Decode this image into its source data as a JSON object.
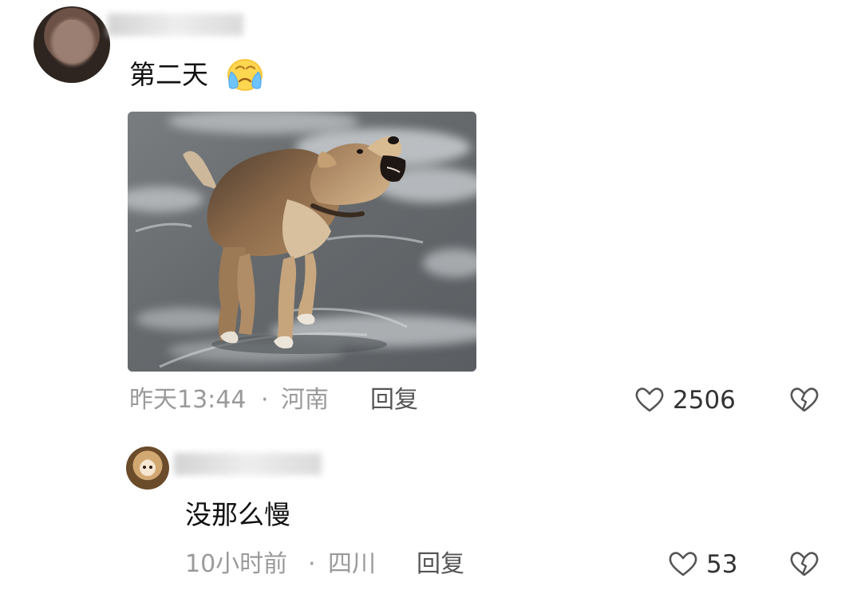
{
  "comments": [
    {
      "text": "第二天",
      "emoji": "crying-face-icon",
      "image": "barking-dog-image",
      "time": "昨天13:44",
      "location": "河南",
      "reply_label": "回复",
      "likes": "2506"
    },
    {
      "text": "没那么慢",
      "time": "10小时前",
      "location": "四川",
      "reply_label": "回复",
      "likes": "53"
    }
  ],
  "meta_separator": "·",
  "colors": {
    "background": "#ffffff",
    "primary_text": "#111111",
    "meta_text": "#9a9a9a",
    "reply_text": "#555555"
  }
}
